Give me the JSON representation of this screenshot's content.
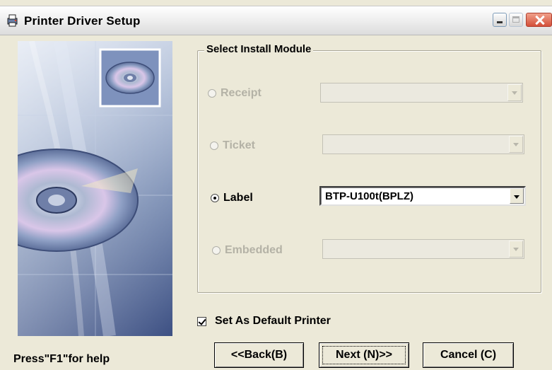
{
  "window": {
    "title": "Printer Driver Setup",
    "icon": "printer-setup-icon"
  },
  "group": {
    "title": "Select Install Module",
    "options": [
      {
        "label": "Receipt",
        "selected": false,
        "enabled": false,
        "combo_value": ""
      },
      {
        "label": "Ticket",
        "selected": false,
        "enabled": false,
        "combo_value": ""
      },
      {
        "label": "Label",
        "selected": true,
        "enabled": true,
        "combo_value": "BTP-U100t(BPLZ)"
      },
      {
        "label": "Embedded",
        "selected": false,
        "enabled": false,
        "combo_value": ""
      }
    ]
  },
  "default_printer": {
    "label": "Set As Default Printer",
    "checked": true
  },
  "buttons": {
    "back": "<<Back(B)",
    "next": "Next (N)>>",
    "cancel": "Cancel (C)"
  },
  "status": {
    "help": "Press\"F1\"for help"
  },
  "colors": {
    "dialog_bg": "#ece9d8",
    "disabled_text": "#b4b2a6",
    "close_button": "#d4503a"
  }
}
